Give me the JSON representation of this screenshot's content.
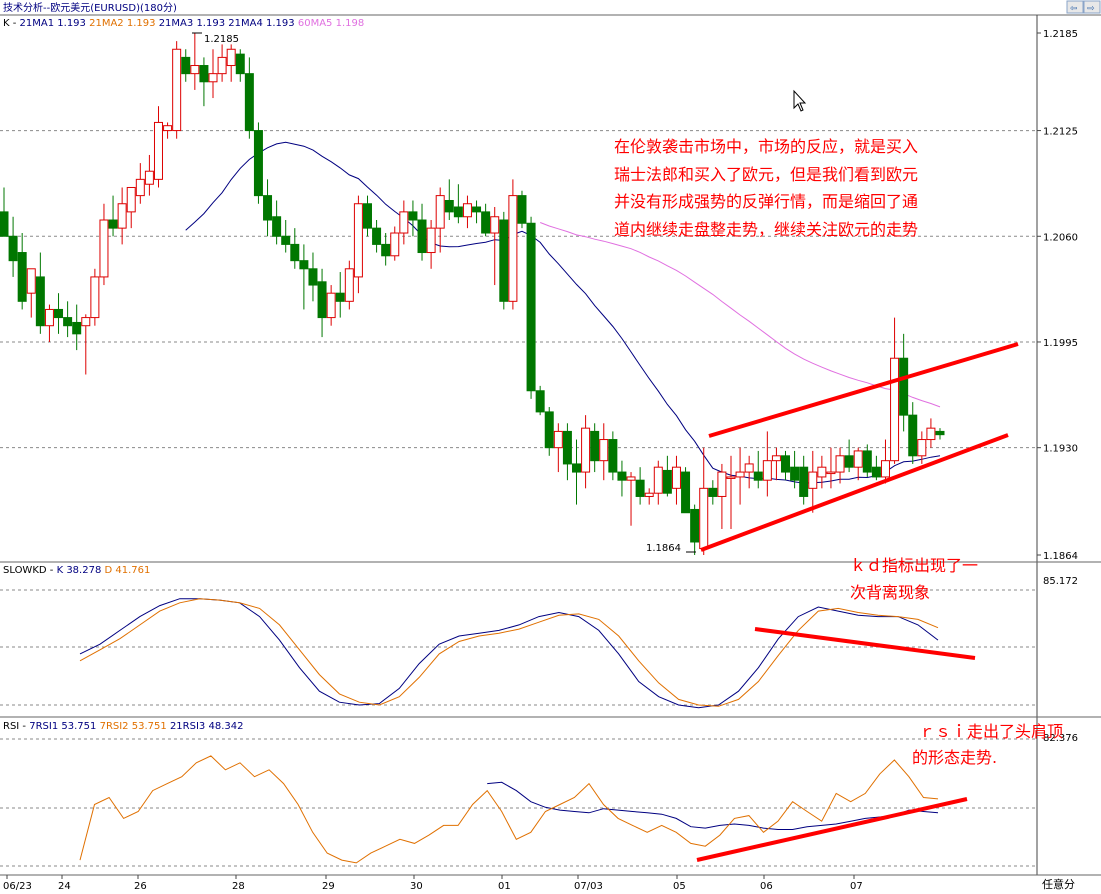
{
  "window": {
    "title": "技术分析--欧元美元(EURUSD)(180分)"
  },
  "legends": {
    "main": {
      "k": "K",
      "sep": " - ",
      "items": [
        {
          "label": "21MA1",
          "value": "1.193",
          "color": "#000080"
        },
        {
          "label": "21MA2",
          "value": "1.193",
          "color": "#e07000"
        },
        {
          "label": "21MA3",
          "value": "1.193",
          "color": "#000080"
        },
        {
          "label": "21MA4",
          "value": "1.193",
          "color": "#000080"
        },
        {
          "label": "60MA5",
          "value": "1.198",
          "color": "#e070e0"
        }
      ]
    },
    "kd": {
      "k": "SLOWKD",
      "sep": " - ",
      "items": [
        {
          "label": "K",
          "value": "38.278",
          "color": "#000080"
        },
        {
          "label": "D",
          "value": "41.761",
          "color": "#e07000"
        }
      ]
    },
    "rsi": {
      "k": "RSI",
      "sep": " - ",
      "items": [
        {
          "label": "7RSI1",
          "value": "53.751",
          "color": "#000080"
        },
        {
          "label": "7RSI2",
          "value": "53.751",
          "color": "#e07000"
        },
        {
          "label": "21RSI3",
          "value": "48.342",
          "color": "#000080"
        }
      ]
    }
  },
  "annotations": {
    "main_comment": [
      "在伦敦袭击市场中，市场的反应，就是买入",
      "瑞士法郎和买入了欧元，但是我们看到欧元",
      "并没有形成强势的反弹行情，而是缩回了通",
      "道内继续走盘整走势，继续关注欧元的走势"
    ],
    "kd_comment": [
      "ｋｄ指标出现了一",
      "次背离现象"
    ],
    "rsi_comment": [
      "ｒｓｉ走出了头肩顶",
      "的形态走势."
    ],
    "high_label": "1.2185",
    "low_label": "1.1864"
  },
  "footer": {
    "mode_label": "任意分"
  },
  "colors": {
    "up": "#dd0000",
    "down": "#007700",
    "grid": "#8a8a8a",
    "ma21": "#000080",
    "ma60": "#e070e0",
    "k_line": "#000080",
    "d_line": "#e07000",
    "trend": "#ff0000",
    "annotation_text": "#ff0000"
  },
  "chart_data": [
    {
      "type": "candlestick",
      "title": "技术分析--欧元美元(EURUSD)(180分)",
      "y_ticks": [
        "1.2185",
        "1.2125",
        "1.2060",
        "1.1995",
        "1.1930",
        "1.1864"
      ],
      "ylim": [
        1.1864,
        1.2185
      ],
      "x_ticks": [
        "06/23",
        "24",
        "26",
        "28",
        "29",
        "30",
        "01",
        "07/03",
        "05",
        "06",
        "07"
      ],
      "candles": [
        {
          "o": 1.2075,
          "h": 1.209,
          "l": 1.206,
          "c": 1.206
        },
        {
          "o": 1.206,
          "h": 1.2072,
          "l": 1.2035,
          "c": 1.2045
        },
        {
          "o": 1.205,
          "h": 1.2062,
          "l": 1.2015,
          "c": 1.202
        },
        {
          "o": 1.2025,
          "h": 1.204,
          "l": 1.201,
          "c": 1.204
        },
        {
          "o": 1.2035,
          "h": 1.205,
          "l": 1.2,
          "c": 1.2005
        },
        {
          "o": 1.2005,
          "h": 1.2018,
          "l": 1.1995,
          "c": 1.2015
        },
        {
          "o": 1.2015,
          "h": 1.2025,
          "l": 1.2,
          "c": 1.201
        },
        {
          "o": 1.201,
          "h": 1.202,
          "l": 1.1998,
          "c": 1.2005
        },
        {
          "o": 1.2007,
          "h": 1.2018,
          "l": 1.199,
          "c": 1.2
        },
        {
          "o": 1.2005,
          "h": 1.2012,
          "l": 1.1975,
          "c": 1.201
        },
        {
          "o": 1.201,
          "h": 1.204,
          "l": 1.2005,
          "c": 1.2035
        },
        {
          "o": 1.2035,
          "h": 1.208,
          "l": 1.203,
          "c": 1.207
        },
        {
          "o": 1.207,
          "h": 1.2085,
          "l": 1.206,
          "c": 1.2065
        },
        {
          "o": 1.2065,
          "h": 1.209,
          "l": 1.2055,
          "c": 1.208
        },
        {
          "o": 1.2075,
          "h": 1.209,
          "l": 1.2065,
          "c": 1.209
        },
        {
          "o": 1.2085,
          "h": 1.2105,
          "l": 1.208,
          "c": 1.2095
        },
        {
          "o": 1.2092,
          "h": 1.211,
          "l": 1.2085,
          "c": 1.21
        },
        {
          "o": 1.2095,
          "h": 1.214,
          "l": 1.209,
          "c": 1.213
        },
        {
          "o": 1.2125,
          "h": 1.213,
          "l": 1.212,
          "c": 1.2128
        },
        {
          "o": 1.2125,
          "h": 1.218,
          "l": 1.212,
          "c": 1.2175
        },
        {
          "o": 1.217,
          "h": 1.2175,
          "l": 1.2155,
          "c": 1.216
        },
        {
          "o": 1.216,
          "h": 1.2185,
          "l": 1.215,
          "c": 1.2165
        },
        {
          "o": 1.2165,
          "h": 1.217,
          "l": 1.214,
          "c": 1.2155
        },
        {
          "o": 1.2155,
          "h": 1.2175,
          "l": 1.2145,
          "c": 1.216
        },
        {
          "o": 1.216,
          "h": 1.2178,
          "l": 1.2155,
          "c": 1.217
        },
        {
          "o": 1.2165,
          "h": 1.2178,
          "l": 1.2155,
          "c": 1.2175
        },
        {
          "o": 1.2172,
          "h": 1.2175,
          "l": 1.2155,
          "c": 1.216
        },
        {
          "o": 1.216,
          "h": 1.217,
          "l": 1.212,
          "c": 1.2125
        },
        {
          "o": 1.2125,
          "h": 1.213,
          "l": 1.208,
          "c": 1.2085
        },
        {
          "o": 1.2085,
          "h": 1.2095,
          "l": 1.206,
          "c": 1.207
        },
        {
          "o": 1.2072,
          "h": 1.2082,
          "l": 1.2055,
          "c": 1.206
        },
        {
          "o": 1.206,
          "h": 1.207,
          "l": 1.205,
          "c": 1.2055
        },
        {
          "o": 1.2055,
          "h": 1.2065,
          "l": 1.204,
          "c": 1.2045
        },
        {
          "o": 1.2045,
          "h": 1.2055,
          "l": 1.2015,
          "c": 1.204
        },
        {
          "o": 1.204,
          "h": 1.205,
          "l": 1.202,
          "c": 1.203
        },
        {
          "o": 1.2032,
          "h": 1.204,
          "l": 1.1998,
          "c": 1.201
        },
        {
          "o": 1.201,
          "h": 1.203,
          "l": 1.2005,
          "c": 1.2025
        },
        {
          "o": 1.2025,
          "h": 1.2038,
          "l": 1.201,
          "c": 1.202
        },
        {
          "o": 1.202,
          "h": 1.2045,
          "l": 1.2015,
          "c": 1.204
        },
        {
          "o": 1.2035,
          "h": 1.2085,
          "l": 1.2025,
          "c": 1.208
        },
        {
          "o": 1.208,
          "h": 1.2085,
          "l": 1.206,
          "c": 1.2065
        },
        {
          "o": 1.2065,
          "h": 1.207,
          "l": 1.205,
          "c": 1.2055
        },
        {
          "o": 1.2055,
          "h": 1.2062,
          "l": 1.2042,
          "c": 1.2048
        },
        {
          "o": 1.2048,
          "h": 1.2066,
          "l": 1.2045,
          "c": 1.2062
        },
        {
          "o": 1.2062,
          "h": 1.2082,
          "l": 1.2055,
          "c": 1.2075
        },
        {
          "o": 1.2075,
          "h": 1.2082,
          "l": 1.206,
          "c": 1.207
        },
        {
          "o": 1.207,
          "h": 1.208,
          "l": 1.2045,
          "c": 1.205
        },
        {
          "o": 1.205,
          "h": 1.207,
          "l": 1.204,
          "c": 1.2065
        },
        {
          "o": 1.2065,
          "h": 1.209,
          "l": 1.205,
          "c": 1.2085
        },
        {
          "o": 1.2082,
          "h": 1.2095,
          "l": 1.207,
          "c": 1.2075
        },
        {
          "o": 1.2078,
          "h": 1.2092,
          "l": 1.2068,
          "c": 1.2072
        },
        {
          "o": 1.2072,
          "h": 1.2085,
          "l": 1.2065,
          "c": 1.208
        },
        {
          "o": 1.2078,
          "h": 1.2082,
          "l": 1.2068,
          "c": 1.2075
        },
        {
          "o": 1.2075,
          "h": 1.208,
          "l": 1.206,
          "c": 1.2062
        },
        {
          "o": 1.2062,
          "h": 1.2078,
          "l": 1.203,
          "c": 1.2072
        },
        {
          "o": 1.207,
          "h": 1.2075,
          "l": 1.2015,
          "c": 1.202
        },
        {
          "o": 1.202,
          "h": 1.2095,
          "l": 1.2015,
          "c": 1.2085
        },
        {
          "o": 1.2085,
          "h": 1.2088,
          "l": 1.2065,
          "c": 1.2068
        },
        {
          "o": 1.2068,
          "h": 1.2072,
          "l": 1.196,
          "c": 1.1965
        },
        {
          "o": 1.1965,
          "h": 1.1968,
          "l": 1.195,
          "c": 1.1952
        },
        {
          "o": 1.1952,
          "h": 1.1955,
          "l": 1.1925,
          "c": 1.193
        },
        {
          "o": 1.193,
          "h": 1.1945,
          "l": 1.1915,
          "c": 1.194
        },
        {
          "o": 1.194,
          "h": 1.1945,
          "l": 1.191,
          "c": 1.192
        },
        {
          "o": 1.192,
          "h": 1.1935,
          "l": 1.1895,
          "c": 1.1915
        },
        {
          "o": 1.1915,
          "h": 1.195,
          "l": 1.1905,
          "c": 1.1942
        },
        {
          "o": 1.194,
          "h": 1.1945,
          "l": 1.1915,
          "c": 1.1922
        },
        {
          "o": 1.1922,
          "h": 1.1945,
          "l": 1.191,
          "c": 1.1935
        },
        {
          "o": 1.1935,
          "h": 1.194,
          "l": 1.191,
          "c": 1.1915
        },
        {
          "o": 1.1915,
          "h": 1.1922,
          "l": 1.19,
          "c": 1.191
        },
        {
          "o": 1.191,
          "h": 1.1915,
          "l": 1.1882,
          "c": 1.1912
        },
        {
          "o": 1.191,
          "h": 1.1918,
          "l": 1.1895,
          "c": 1.19
        },
        {
          "o": 1.19,
          "h": 1.1905,
          "l": 1.1895,
          "c": 1.1902
        },
        {
          "o": 1.1902,
          "h": 1.1922,
          "l": 1.1895,
          "c": 1.1918
        },
        {
          "o": 1.1916,
          "h": 1.1925,
          "l": 1.19,
          "c": 1.1902
        },
        {
          "o": 1.1905,
          "h": 1.1925,
          "l": 1.1895,
          "c": 1.1918
        },
        {
          "o": 1.1915,
          "h": 1.1918,
          "l": 1.189,
          "c": 1.189
        },
        {
          "o": 1.1892,
          "h": 1.1895,
          "l": 1.1864,
          "c": 1.1872
        },
        {
          "o": 1.1868,
          "h": 1.193,
          "l": 1.1864,
          "c": 1.1905
        },
        {
          "o": 1.1905,
          "h": 1.191,
          "l": 1.1895,
          "c": 1.19
        },
        {
          "o": 1.19,
          "h": 1.192,
          "l": 1.188,
          "c": 1.1915
        },
        {
          "o": 1.1912,
          "h": 1.1925,
          "l": 1.188,
          "c": 1.1912
        },
        {
          "o": 1.1912,
          "h": 1.193,
          "l": 1.1895,
          "c": 1.1915
        },
        {
          "o": 1.1915,
          "h": 1.1925,
          "l": 1.1905,
          "c": 1.192
        },
        {
          "o": 1.1915,
          "h": 1.1928,
          "l": 1.1905,
          "c": 1.191
        },
        {
          "o": 1.191,
          "h": 1.194,
          "l": 1.19,
          "c": 1.1922
        },
        {
          "o": 1.1922,
          "h": 1.193,
          "l": 1.191,
          "c": 1.1925
        },
        {
          "o": 1.1925,
          "h": 1.1928,
          "l": 1.191,
          "c": 1.1915
        },
        {
          "o": 1.1918,
          "h": 1.1928,
          "l": 1.1905,
          "c": 1.191
        },
        {
          "o": 1.1918,
          "h": 1.1925,
          "l": 1.1895,
          "c": 1.19
        },
        {
          "o": 1.1905,
          "h": 1.1928,
          "l": 1.189,
          "c": 1.1915
        },
        {
          "o": 1.1912,
          "h": 1.1925,
          "l": 1.1905,
          "c": 1.1918
        },
        {
          "o": 1.1915,
          "h": 1.193,
          "l": 1.1905,
          "c": 1.1915
        },
        {
          "o": 1.1915,
          "h": 1.193,
          "l": 1.1908,
          "c": 1.1925
        },
        {
          "o": 1.1925,
          "h": 1.1935,
          "l": 1.1915,
          "c": 1.1918
        },
        {
          "o": 1.1918,
          "h": 1.193,
          "l": 1.191,
          "c": 1.1928
        },
        {
          "o": 1.1928,
          "h": 1.1932,
          "l": 1.1912,
          "c": 1.1915
        },
        {
          "o": 1.1918,
          "h": 1.1925,
          "l": 1.191,
          "c": 1.1912
        },
        {
          "o": 1.1912,
          "h": 1.1935,
          "l": 1.1908,
          "c": 1.1922
        },
        {
          "o": 1.1922,
          "h": 1.201,
          "l": 1.192,
          "c": 1.1985
        },
        {
          "o": 1.1985,
          "h": 1.2,
          "l": 1.194,
          "c": 1.195
        },
        {
          "o": 1.195,
          "h": 1.1958,
          "l": 1.192,
          "c": 1.1925
        },
        {
          "o": 1.1925,
          "h": 1.194,
          "l": 1.192,
          "c": 1.1935
        },
        {
          "o": 1.1935,
          "h": 1.1948,
          "l": 1.193,
          "c": 1.1942
        },
        {
          "o": 1.194,
          "h": 1.1942,
          "l": 1.1935,
          "c": 1.1938
        }
      ]
    },
    {
      "type": "line",
      "title": "SLOWKD",
      "ylim": [
        0,
        100
      ],
      "y_ticks": [
        "85.172"
      ],
      "series": [
        {
          "name": "K",
          "color": "#000080",
          "values": [
            45,
            52,
            62,
            72,
            80,
            85,
            85,
            84,
            82,
            72,
            55,
            35,
            18,
            10,
            8,
            9,
            20,
            38,
            52,
            58,
            60,
            62,
            66,
            72,
            75,
            72,
            62,
            45,
            25,
            14,
            8,
            6,
            8,
            18,
            35,
            56,
            72,
            79,
            76,
            73,
            72,
            72,
            66,
            55
          ]
        },
        {
          "name": "D",
          "color": "#e07000",
          "values": [
            40,
            48,
            56,
            66,
            76,
            82,
            85,
            84,
            82,
            78,
            66,
            48,
            30,
            16,
            10,
            8,
            14,
            28,
            45,
            54,
            58,
            60,
            63,
            68,
            73,
            74,
            70,
            58,
            40,
            24,
            12,
            8,
            7,
            12,
            25,
            44,
            62,
            76,
            78,
            75,
            73,
            72,
            70,
            64
          ]
        }
      ]
    },
    {
      "type": "line",
      "title": "RSI",
      "ylim": [
        0,
        100
      ],
      "y_ticks": [
        "82.376"
      ],
      "series": [
        {
          "name": "7RSI1",
          "color": "#000080",
          "values": [
            null,
            null,
            null,
            null,
            null,
            null,
            null,
            null,
            null,
            null,
            null,
            null,
            null,
            null,
            null,
            null,
            null,
            null,
            null,
            null,
            null,
            null,
            null,
            null,
            null,
            null,
            null,
            null,
            65,
            66,
            60,
            52,
            48,
            46,
            45,
            44,
            47,
            46,
            45,
            44,
            43,
            40,
            34,
            33,
            35,
            36,
            35,
            33,
            32,
            32,
            34,
            35,
            36,
            38,
            40,
            41,
            42,
            46,
            45,
            44
          ]
        },
        {
          "name": "7RSI2",
          "color": "#e07000",
          "values": [
            10,
            50,
            55,
            40,
            45,
            60,
            65,
            70,
            80,
            85,
            75,
            80,
            70,
            75,
            65,
            50,
            30,
            15,
            10,
            8,
            15,
            20,
            25,
            22,
            28,
            35,
            35,
            50,
            60,
            45,
            25,
            30,
            45,
            50,
            55,
            65,
            50,
            40,
            35,
            30,
            35,
            30,
            22,
            20,
            28,
            40,
            42,
            30,
            38,
            52,
            45,
            38,
            58,
            52,
            58,
            72,
            82,
            70,
            55,
            54
          ]
        }
      ]
    }
  ]
}
